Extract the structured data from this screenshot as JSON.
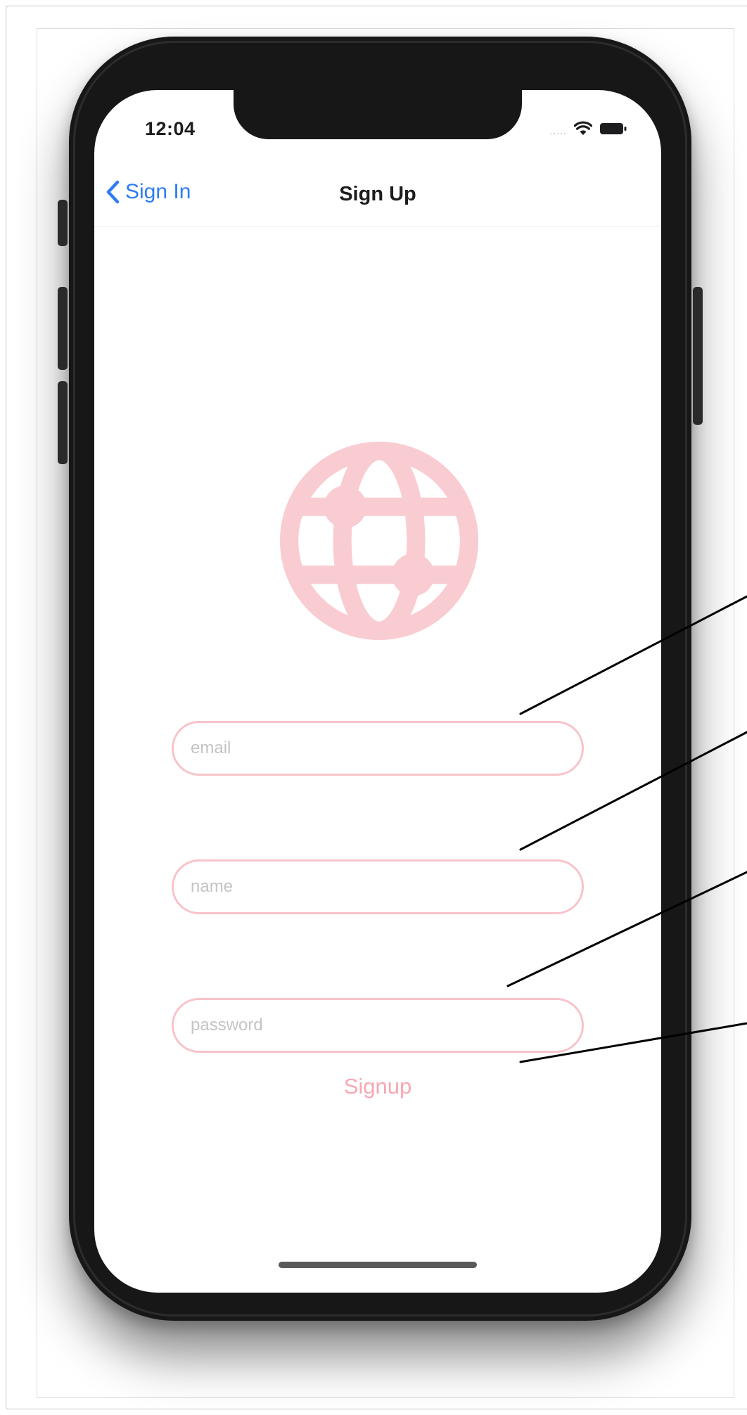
{
  "status_bar": {
    "time": "12:04",
    "signal": "....."
  },
  "nav": {
    "back_label": "Sign In",
    "title": "Sign Up"
  },
  "form": {
    "email_placeholder": "email",
    "name_placeholder": "name",
    "password_placeholder": "password",
    "signup_label": "Signup"
  },
  "icons": {
    "back": "chevron-left-icon",
    "logo": "globe-icon",
    "wifi": "wifi-icon",
    "battery": "battery-icon"
  },
  "colors": {
    "accent_blue": "#2d7cf6",
    "logo_pink": "#f9ccd2",
    "field_border": "#f8c3c9",
    "signup_text": "#f7a7b3"
  }
}
